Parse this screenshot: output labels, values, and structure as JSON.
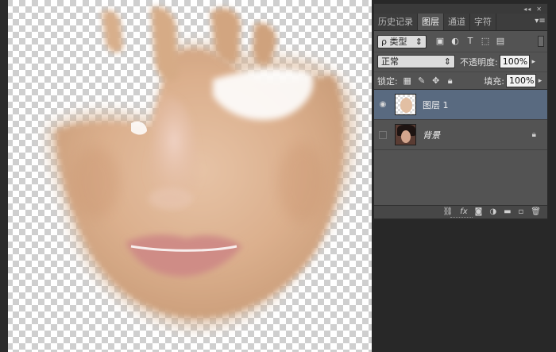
{
  "panel": {
    "collapse_glyph": "◂◂",
    "close_glyph": "✕",
    "tabs": [
      {
        "label": "历史记录",
        "active": false
      },
      {
        "label": "图层",
        "active": true
      },
      {
        "label": "通道",
        "active": false
      },
      {
        "label": "字符",
        "active": false
      }
    ],
    "menu_icon": "panel-menu-icon"
  },
  "filter": {
    "label": "ρ 类型",
    "icons": [
      "image-filter-icon",
      "adjustment-filter-icon",
      "type-filter-icon",
      "shape-filter-icon",
      "smart-object-filter-icon"
    ]
  },
  "blend": {
    "mode": "正常",
    "opacity_label": "不透明度:",
    "opacity_value": "100%"
  },
  "lock": {
    "label": "锁定:",
    "icons": [
      "lock-transparent-icon",
      "lock-image-icon",
      "lock-position-icon",
      "lock-all-icon"
    ],
    "fill_label": "填充:",
    "fill_value": "100%"
  },
  "layers": [
    {
      "name": "图层 1",
      "visible": true,
      "selected": true,
      "locked": false
    },
    {
      "name": "背景",
      "visible": false,
      "selected": false,
      "locked": true
    }
  ],
  "footer_icons": [
    "link-layers-icon",
    "fx-icon",
    "add-mask-icon",
    "adjustment-layer-icon",
    "new-group-icon",
    "new-layer-icon",
    "delete-layer-icon"
  ],
  "colors": {
    "panel_bg": "#535353",
    "selected_layer": "#596a80",
    "app_bg": "#282828"
  }
}
